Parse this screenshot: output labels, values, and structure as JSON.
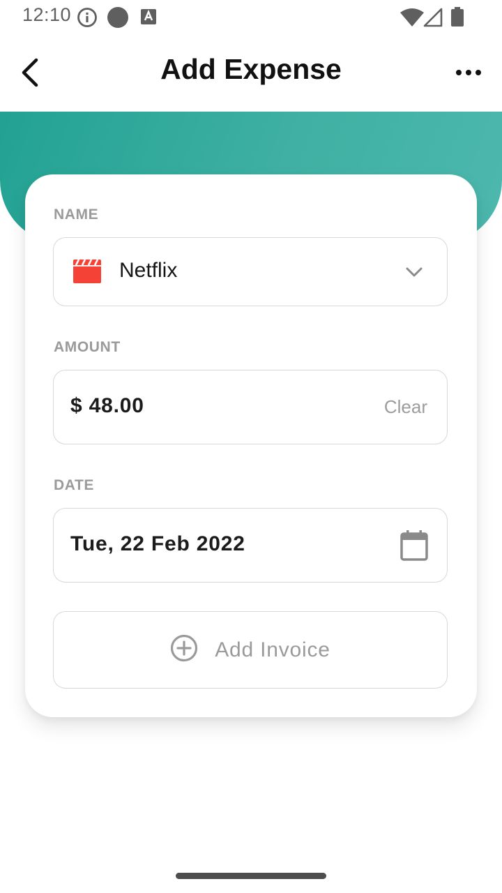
{
  "status_bar": {
    "time": "12:10",
    "icons": [
      "info-icon",
      "record-dot-icon",
      "font-a-icon",
      "wifi-icon",
      "signal-icon",
      "battery-icon"
    ]
  },
  "app_bar": {
    "title": "Add Expense",
    "back_icon": "chevron-left-icon",
    "menu_icon": "more-horizontal-icon"
  },
  "theme": {
    "accent": "#2ba89a",
    "brand_icon_color": "#f44336",
    "label_color": "#9a9a9a"
  },
  "form": {
    "name": {
      "label": "NAME",
      "value": "Netflix",
      "icon": "movie-clapper-icon"
    },
    "amount": {
      "label": "AMOUNT",
      "value": "$ 48.00",
      "clear_label": "Clear"
    },
    "date": {
      "label": "DATE",
      "value": "Tue, 22 Feb 2022",
      "icon": "calendar-icon"
    },
    "invoice": {
      "label": "Add Invoice",
      "icon": "add-circle-icon"
    }
  }
}
